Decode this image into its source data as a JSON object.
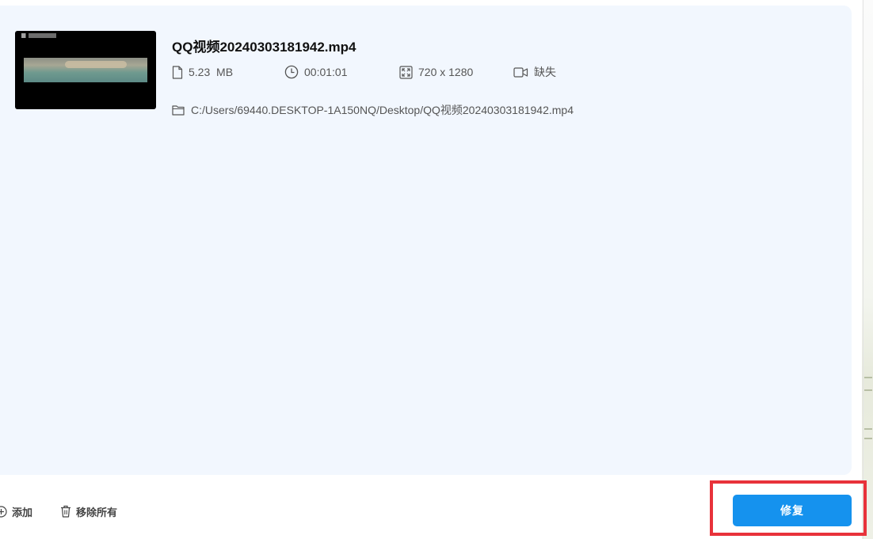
{
  "file": {
    "name": "QQ视频20240303181942.mp4",
    "size": "5.23  MB",
    "duration": "00:01:01",
    "resolution": "720 x 1280",
    "codec": "缺失",
    "path": "C:/Users/69440.DESKTOP-1A150NQ/Desktop/QQ视频20240303181942.mp4"
  },
  "toolbar": {
    "add_label": "添加",
    "remove_all_label": "移除所有"
  },
  "actions": {
    "repair_label": "修复"
  },
  "colors": {
    "panel_background": "#f2f7fe",
    "primary_button": "#1592ee",
    "highlight_border": "#e8323a"
  },
  "icons": [
    "file-icon",
    "clock-icon",
    "resize-icon",
    "video-camera-icon",
    "folder-icon",
    "plus-circle-icon",
    "trash-icon"
  ]
}
